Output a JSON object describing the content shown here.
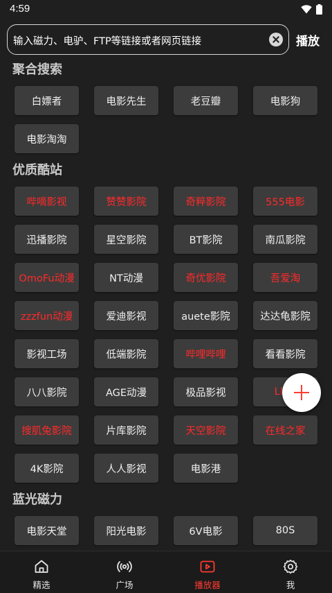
{
  "status": {
    "time": "4:59"
  },
  "search": {
    "placeholder": "输入磁力、电驴、FTP等链接或者网页链接",
    "action_label": "播放"
  },
  "sections": [
    {
      "title": "聚合搜索",
      "items": [
        {
          "label": "白嫖者",
          "highlight": false
        },
        {
          "label": "电影先生",
          "highlight": false
        },
        {
          "label": "老豆瓣",
          "highlight": false
        },
        {
          "label": "电影狗",
          "highlight": false
        },
        {
          "label": "电影淘淘",
          "highlight": false
        }
      ]
    },
    {
      "title": "优质酷站",
      "items": [
        {
          "label": "哔嘀影视",
          "highlight": true
        },
        {
          "label": "赞赞影院",
          "highlight": true
        },
        {
          "label": "奇粹影院",
          "highlight": true
        },
        {
          "label": "555电影",
          "highlight": true
        },
        {
          "label": "迅播影院",
          "highlight": false
        },
        {
          "label": "星空影院",
          "highlight": false
        },
        {
          "label": "BT影院",
          "highlight": false
        },
        {
          "label": "南瓜影院",
          "highlight": false
        },
        {
          "label": "OmoFu动漫",
          "highlight": true
        },
        {
          "label": "NT动漫",
          "highlight": false
        },
        {
          "label": "奇优影院",
          "highlight": true
        },
        {
          "label": "吾爱淘",
          "highlight": true
        },
        {
          "label": "zzzfun动漫",
          "highlight": true
        },
        {
          "label": "爱迪影视",
          "highlight": false
        },
        {
          "label": "auete影院",
          "highlight": false
        },
        {
          "label": "达达龟影院",
          "highlight": false
        },
        {
          "label": "影视工场",
          "highlight": false
        },
        {
          "label": "低端影院",
          "highlight": false
        },
        {
          "label": "哔哩哔哩",
          "highlight": true
        },
        {
          "label": "看看影院",
          "highlight": false
        },
        {
          "label": "八八影院",
          "highlight": false
        },
        {
          "label": "AGE动漫",
          "highlight": false
        },
        {
          "label": "极品影视",
          "highlight": false
        },
        {
          "label": "LIBV",
          "highlight": true
        },
        {
          "label": "搜肌兔影院",
          "highlight": true
        },
        {
          "label": "片库影院",
          "highlight": false
        },
        {
          "label": "天空影院",
          "highlight": true
        },
        {
          "label": "在线之家",
          "highlight": true
        },
        {
          "label": "4K影院",
          "highlight": false
        },
        {
          "label": "人人影视",
          "highlight": false
        },
        {
          "label": "电影港",
          "highlight": false
        }
      ]
    },
    {
      "title": "蓝光磁力",
      "items": [
        {
          "label": "电影天堂",
          "highlight": false
        },
        {
          "label": "阳光电影",
          "highlight": false
        },
        {
          "label": "6V电影",
          "highlight": false
        },
        {
          "label": "80S",
          "highlight": false
        }
      ]
    }
  ],
  "nav": [
    {
      "label": "精选",
      "icon": "home-icon",
      "active": false
    },
    {
      "label": "广场",
      "icon": "broadcast-icon",
      "active": false
    },
    {
      "label": "播放器",
      "icon": "play-box-icon",
      "active": true
    },
    {
      "label": "我",
      "icon": "gear-icon",
      "active": false
    }
  ],
  "colors": {
    "accent": "#ff3b30",
    "chip_bg": "#3c3c3c",
    "background": "#1f1f1f"
  }
}
